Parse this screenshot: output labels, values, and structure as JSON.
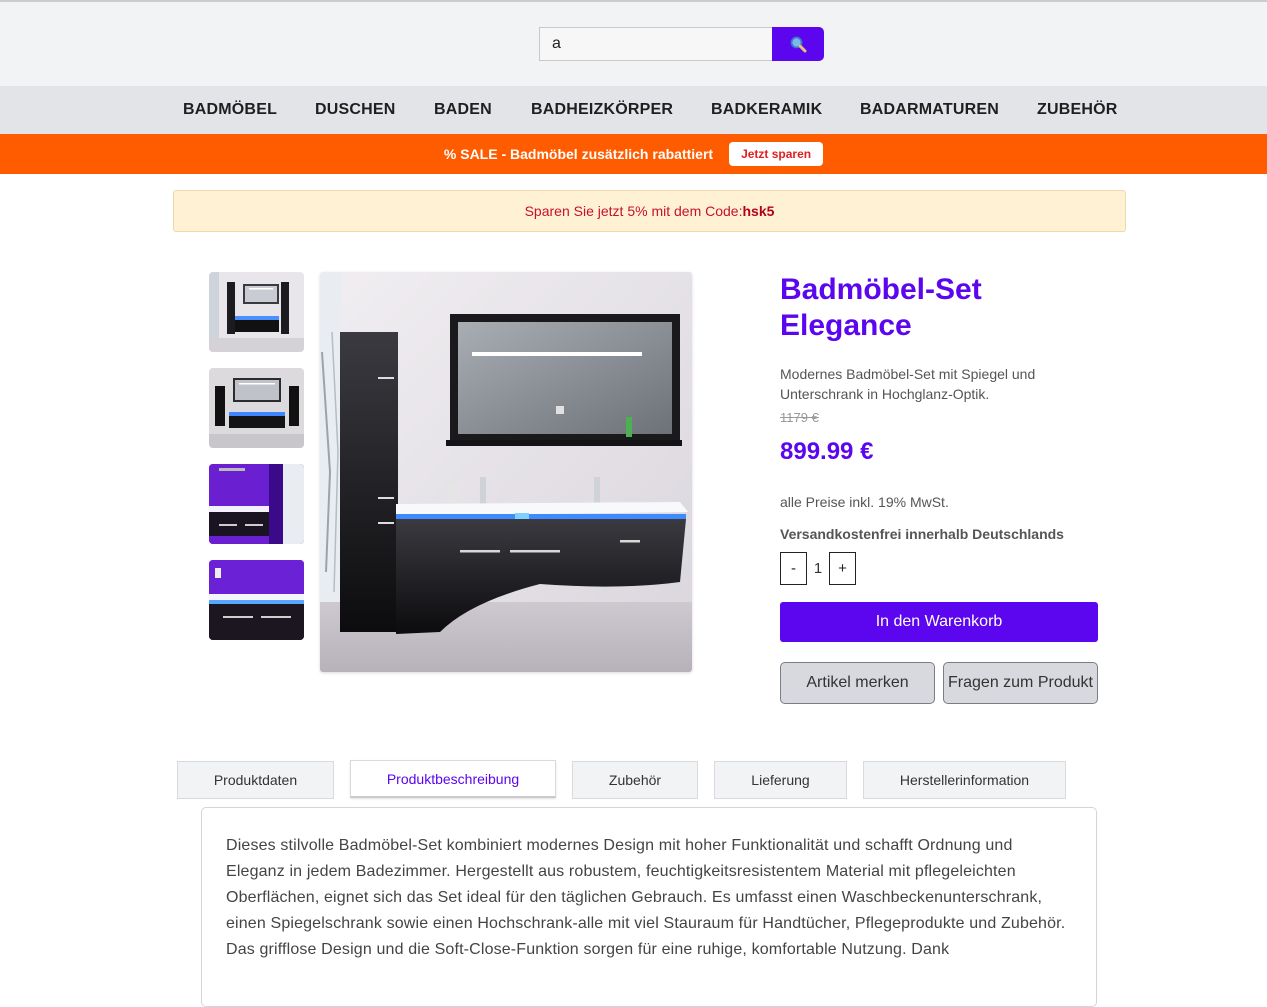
{
  "search": {
    "value": "a",
    "icon": "search-icon"
  },
  "nav": {
    "items": [
      {
        "label": "BADMÖBEL"
      },
      {
        "label": "DUSCHEN"
      },
      {
        "label": "BADEN"
      },
      {
        "label": "BADHEIZKÖRPER"
      },
      {
        "label": "BADKERAMIK"
      },
      {
        "label": "BADARMATUREN"
      },
      {
        "label": "ZUBEHÖR"
      }
    ]
  },
  "sale_banner": {
    "text": "% SALE - Badmöbel zusätzlich rabattiert",
    "button": "Jetzt sparen"
  },
  "promo": {
    "text": "Sparen Sie jetzt 5% mit dem Code:",
    "code": "hsk5"
  },
  "product": {
    "title": "Badmöbel-Set Elegance",
    "description": "Modernes Badmöbel-Set mit Spiegel und Unterschrank in Hochglanz-Optik.",
    "old_price": "1179 €",
    "price": "899.99 €",
    "tax_note": "alle Preise inkl. 19% MwSt.",
    "shipping": "Versandkostenfrei innerhalb Deutschlands",
    "quantity": "1",
    "qty_minus": "-",
    "qty_plus": "+",
    "add_to_cart": "In den Warenkorb",
    "wishlist": "Artikel merken",
    "ask": "Fragen zum Produkt"
  },
  "tabs": [
    {
      "label": "Produktdaten"
    },
    {
      "label": "Produktbeschreibung"
    },
    {
      "label": "Zubehör"
    },
    {
      "label": "Lieferung"
    },
    {
      "label": "Herstellerinformation"
    }
  ],
  "active_tab": "Produktbeschreibung",
  "description_text": "Dieses stilvolle Badmöbel-Set kombiniert modernes Design mit hoher Funktionalität und schafft Ordnung und Eleganz in jedem Badezimmer. Hergestellt aus robustem, feuchtigkeitsresistentem Material mit pflegeleichten Oberflächen, eignet sich das Set ideal für den täglichen Gebrauch. Es umfasst einen Waschbeckenunterschrank, einen Spiegelschrank sowie einen Hochschrank-alle mit viel Stauraum für Handtücher, Pflegeprodukte und Zubehör. Das grifflose Design und die Soft-Close-Funktion sorgen für eine ruhige, komfortable Nutzung. Dank",
  "colors": {
    "accent": "#5b06ef",
    "sale_banner": "#ff5c00",
    "promo_bg": "#fff1d4",
    "promo_text": "#c8102e"
  }
}
